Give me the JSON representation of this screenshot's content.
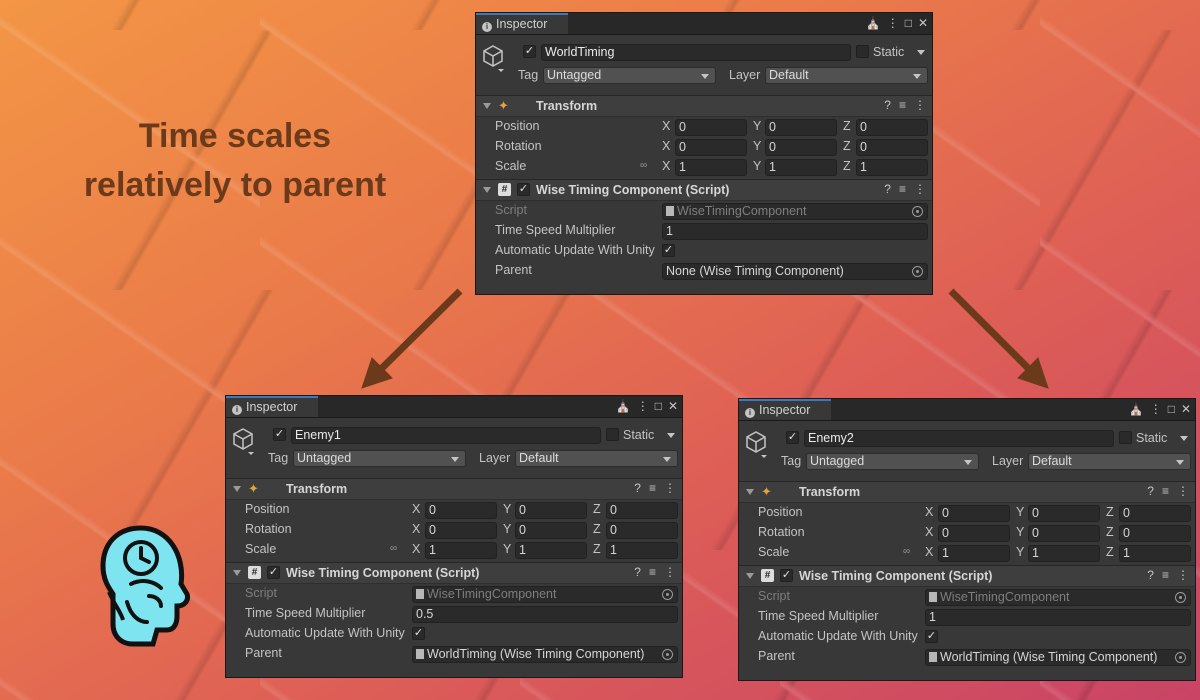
{
  "headline": [
    "Time scales",
    "relatively to parent"
  ],
  "colors": {
    "accent": "#3a79bb",
    "headline": "#6b3a1a",
    "arrow": "#6b3a1a",
    "brain": "#7de4f0"
  },
  "inspectors": [
    {
      "tab": "Inspector",
      "name": "WorldTiming",
      "static_label": "Static",
      "tag_label": "Tag",
      "tag": "Untagged",
      "layer_label": "Layer",
      "layer": "Default",
      "transform": {
        "title": "Transform",
        "position": {
          "label": "Position",
          "x": "0",
          "y": "0",
          "z": "0"
        },
        "rotation": {
          "label": "Rotation",
          "x": "0",
          "y": "0",
          "z": "0"
        },
        "scale": {
          "label": "Scale",
          "x": "1",
          "y": "1",
          "z": "1"
        }
      },
      "component": {
        "title": "Wise Timing Component (Script)",
        "script_label": "Script",
        "script": "WiseTimingComponent",
        "speed_label": "Time Speed Multiplier",
        "speed": "1",
        "auto_label": "Automatic Update With Unity",
        "parent_label": "Parent",
        "parent": "None (Wise Timing Component)"
      }
    },
    {
      "tab": "Inspector",
      "name": "Enemy1",
      "static_label": "Static",
      "tag_label": "Tag",
      "tag": "Untagged",
      "layer_label": "Layer",
      "layer": "Default",
      "transform": {
        "title": "Transform",
        "position": {
          "label": "Position",
          "x": "0",
          "y": "0",
          "z": "0"
        },
        "rotation": {
          "label": "Rotation",
          "x": "0",
          "y": "0",
          "z": "0"
        },
        "scale": {
          "label": "Scale",
          "x": "1",
          "y": "1",
          "z": "1"
        }
      },
      "component": {
        "title": "Wise Timing Component (Script)",
        "script_label": "Script",
        "script": "WiseTimingComponent",
        "speed_label": "Time Speed Multiplier",
        "speed": "0.5",
        "auto_label": "Automatic Update With Unity",
        "parent_label": "Parent",
        "parent": "WorldTiming (Wise Timing Component)"
      }
    },
    {
      "tab": "Inspector",
      "name": "Enemy2",
      "static_label": "Static",
      "tag_label": "Tag",
      "tag": "Untagged",
      "layer_label": "Layer",
      "layer": "Default",
      "transform": {
        "title": "Transform",
        "position": {
          "label": "Position",
          "x": "0",
          "y": "0",
          "z": "0"
        },
        "rotation": {
          "label": "Rotation",
          "x": "0",
          "y": "0",
          "z": "0"
        },
        "scale": {
          "label": "Scale",
          "x": "1",
          "y": "1",
          "z": "1"
        }
      },
      "component": {
        "title": "Wise Timing Component (Script)",
        "script_label": "Script",
        "script": "WiseTimingComponent",
        "speed_label": "Time Speed Multiplier",
        "speed": "1",
        "auto_label": "Automatic Update With Unity",
        "parent_label": "Parent",
        "parent": "WorldTiming (Wise Timing Component)"
      }
    }
  ]
}
